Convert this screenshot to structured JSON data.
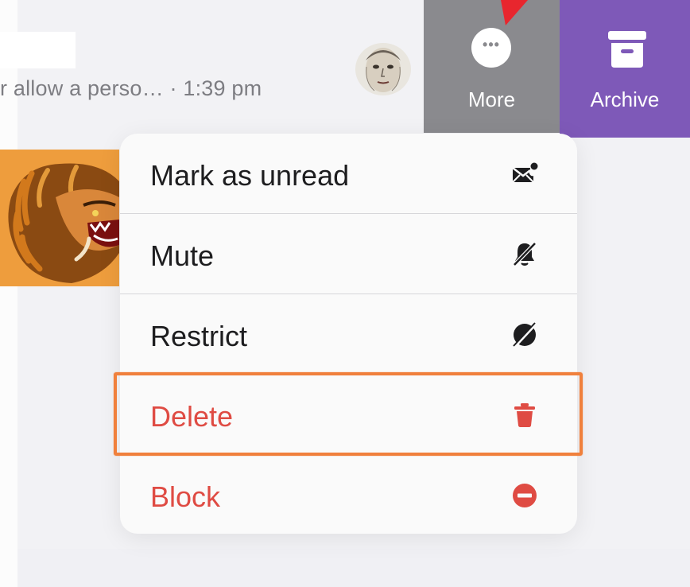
{
  "conversation": {
    "preview_text": "r allow a perso…",
    "time": "· 1:39 pm"
  },
  "swipe_actions": {
    "more": {
      "label": "More",
      "icon": "more-dots-icon",
      "color": "#8a8a8e"
    },
    "archive": {
      "label": "Archive",
      "icon": "archive-box-icon",
      "color": "#7e59b8"
    }
  },
  "context_menu": {
    "items": [
      {
        "label": "Mark as unread",
        "icon": "envelope-unread-icon",
        "destructive": false
      },
      {
        "label": "Mute",
        "icon": "bell-slash-icon",
        "destructive": false
      },
      {
        "label": "Restrict",
        "icon": "restrict-slash-icon",
        "destructive": false
      },
      {
        "label": "Delete",
        "icon": "trash-icon",
        "destructive": true,
        "highlighted": true
      },
      {
        "label": "Block",
        "icon": "block-minus-icon",
        "destructive": true
      }
    ]
  },
  "colors": {
    "destructive": "#df4b43",
    "highlight_outline": "#f0803c",
    "pointer": "#e8262e"
  }
}
